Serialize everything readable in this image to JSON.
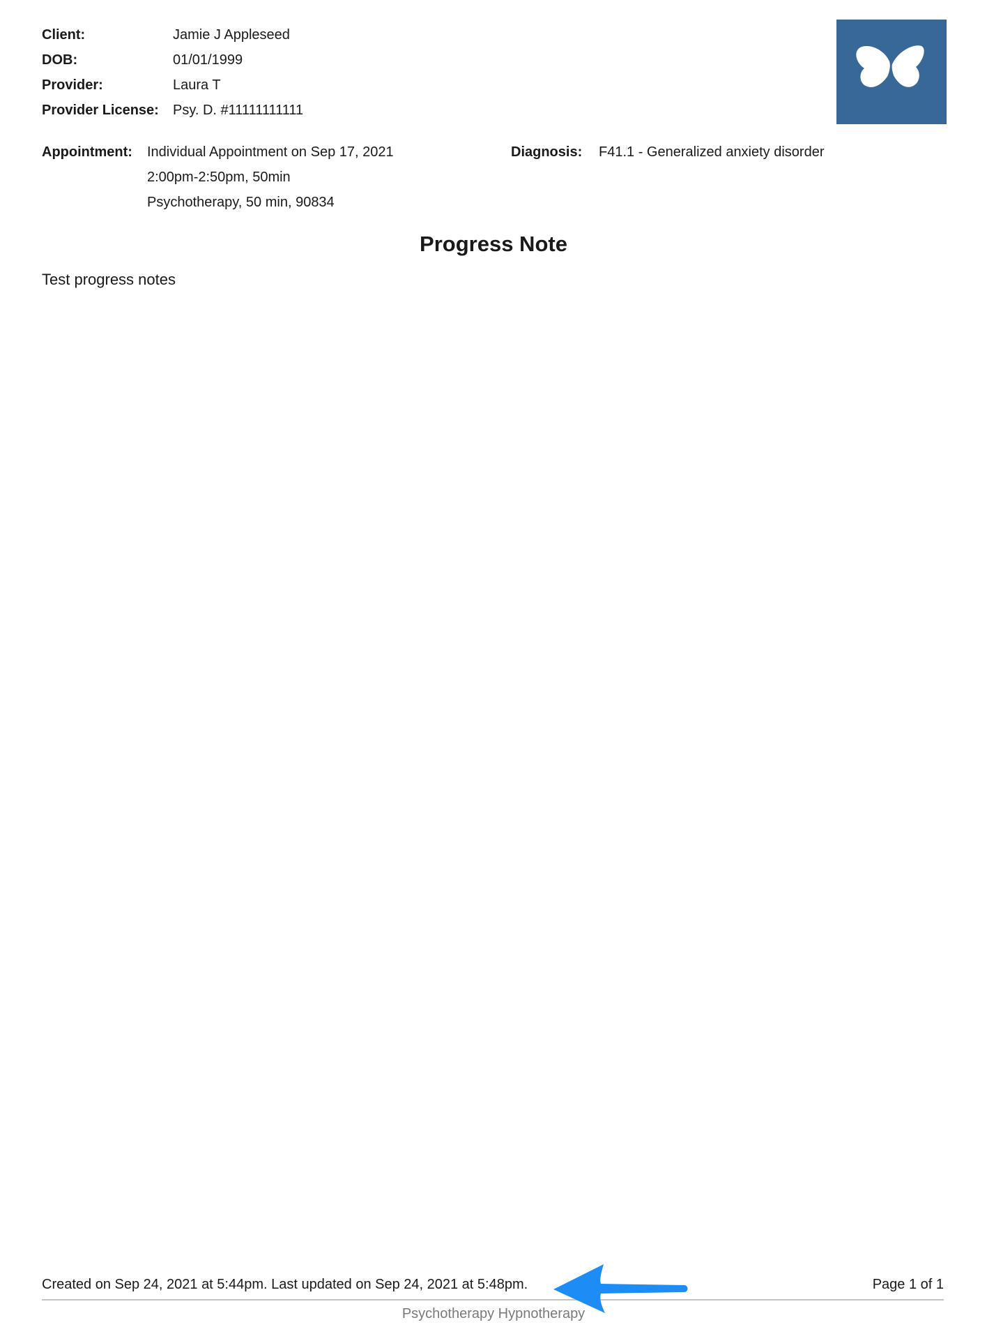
{
  "client_info": {
    "rows": [
      {
        "label": "Client:",
        "value": "Jamie J Appleseed"
      },
      {
        "label": "DOB:",
        "value": "01/01/1999"
      },
      {
        "label": "Provider:",
        "value": "Laura T"
      },
      {
        "label": "Provider License:",
        "value": "Psy. D. #11111111111"
      }
    ]
  },
  "logo": {
    "icon": "butterfly-icon",
    "background_color": "#386898"
  },
  "appointment": {
    "label": "Appointment:",
    "lines": [
      "Individual Appointment on Sep 17, 2021",
      "2:00pm-2:50pm, 50min",
      "Psychotherapy, 50 min, 90834"
    ]
  },
  "diagnosis": {
    "label": "Diagnosis:",
    "value": "F41.1 - Generalized anxiety disorder"
  },
  "document": {
    "title": "Progress Note",
    "body": "Test progress notes"
  },
  "footer": {
    "meta": "Created on Sep 24, 2021 at 5:44pm. Last updated on Sep 24, 2021 at 5:48pm.",
    "page": "Page 1 of 1",
    "practice": "Psychotherapy Hypnotherapy"
  },
  "annotation": {
    "icon": "arrow-left-icon",
    "color": "#1e8cf5"
  }
}
